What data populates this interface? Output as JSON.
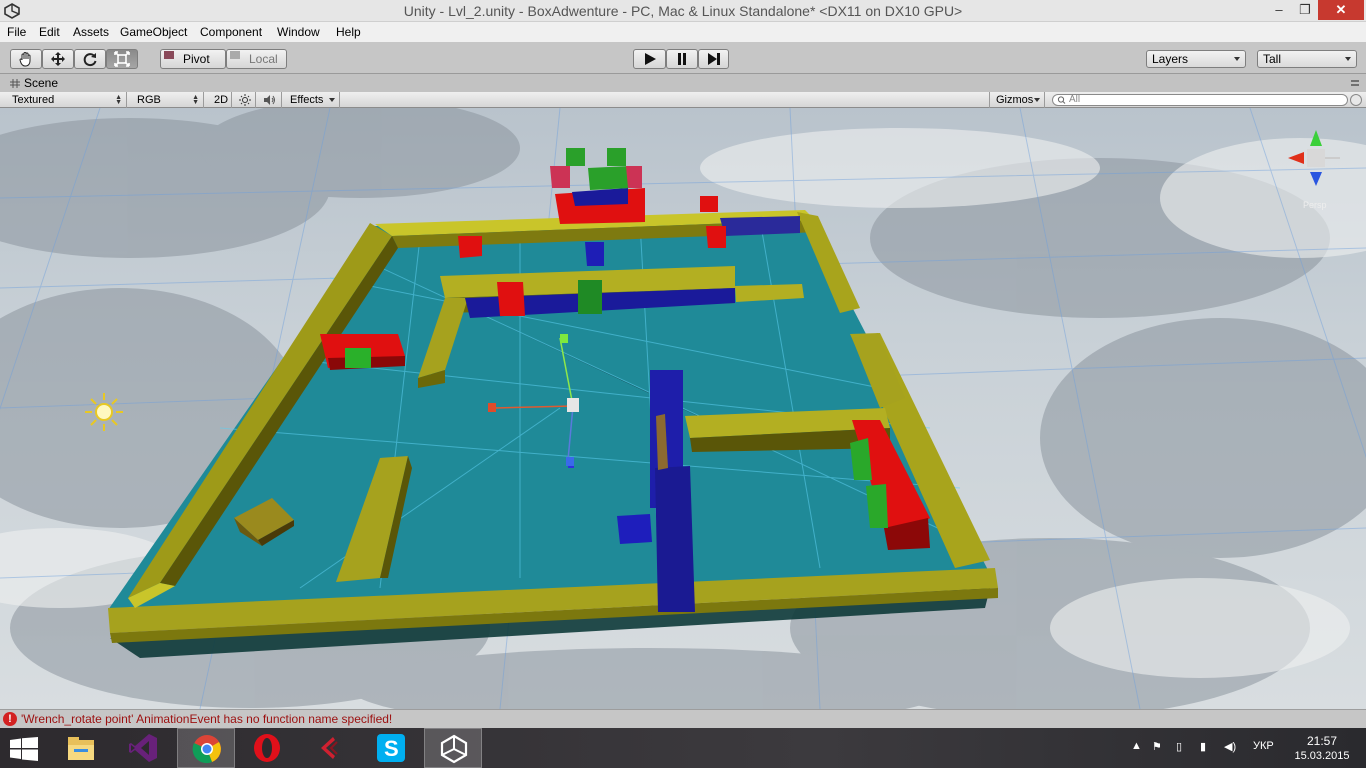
{
  "window": {
    "title": "Unity - Lvl_2.unity - BoxAdwenture - PC, Mac & Linux Standalone* <DX11 on DX10 GPU>",
    "minimize": "–",
    "restore": "❐",
    "close": "✕"
  },
  "menu": [
    "File",
    "Edit",
    "Assets",
    "GameObject",
    "Component",
    "Window",
    "Help"
  ],
  "toolbar": {
    "tools": [
      "hand-icon",
      "move-icon",
      "rotate-icon",
      "scale-icon"
    ],
    "active_tool": "scale-icon",
    "pivot_label": "Pivot",
    "local_label": "Local",
    "layers_label": "Layers",
    "layout_label": "Tall"
  },
  "scene": {
    "tab_label": "Scene",
    "render_mode": "Textured",
    "color_mode": "RGB",
    "toggle_2d": "2D",
    "effects_label": "Effects",
    "gizmos_label": "Gizmos",
    "search_placeholder": "All",
    "persp_label": "Persp"
  },
  "status": {
    "error_icon": "!",
    "message": "'Wrench_rotate point' AnimationEvent has no function name specified!"
  },
  "taskbar": {
    "apps": [
      "file-explorer-icon",
      "visual-studio-icon",
      "chrome-icon",
      "opera-icon",
      "cinema-icon",
      "skype-icon",
      "unity-icon"
    ],
    "active_app": "unity-icon",
    "language": "УКР",
    "time": "21:57",
    "date": "15.03.2015"
  },
  "colors": {
    "floor": "#1f8a98",
    "wall": "#a6a21e",
    "red_block": "#e01010",
    "blue_block": "#1a1a9a",
    "green_block": "#1aa020"
  }
}
